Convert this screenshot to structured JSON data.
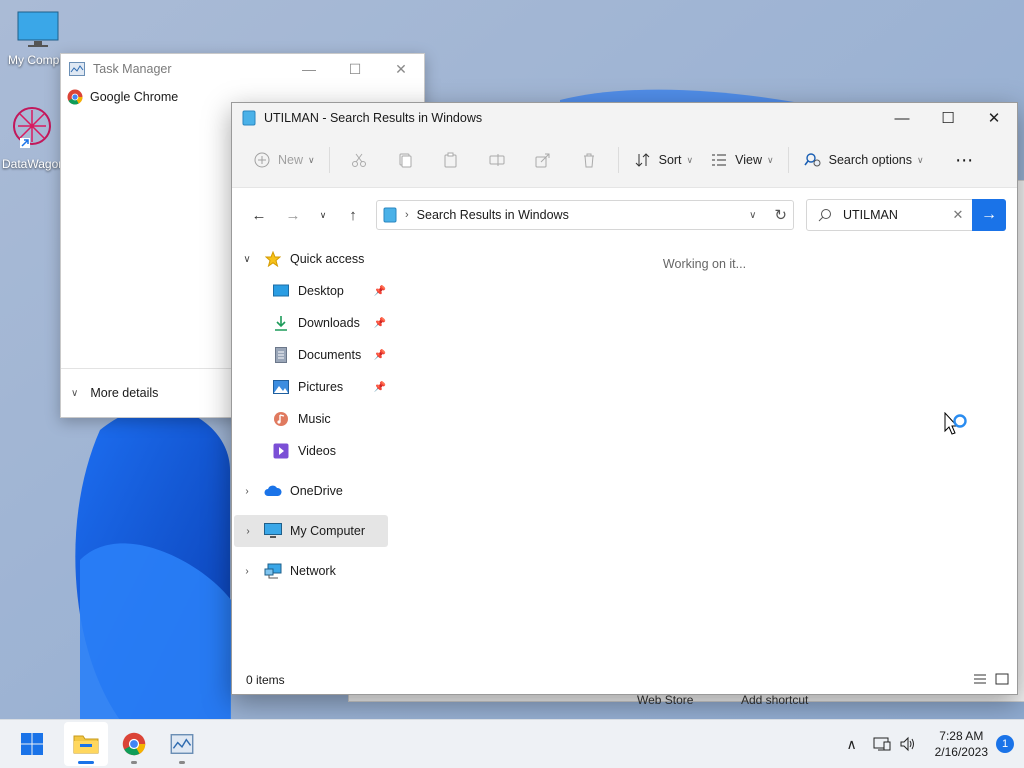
{
  "desktop": {
    "icons": [
      {
        "label": "My Computer"
      },
      {
        "label": "DataWagon"
      }
    ]
  },
  "task_manager": {
    "title": "Task Manager",
    "processes": [
      {
        "name": "Google Chrome"
      }
    ],
    "footer": "More details"
  },
  "behind_window": {
    "texts": [
      "Web Store",
      "Add shortcut"
    ]
  },
  "explorer": {
    "title": "UTILMAN - Search Results in Windows",
    "commands": {
      "new": "New",
      "sort": "Sort",
      "view": "View",
      "search_options": "Search options"
    },
    "address": "Search Results in Windows",
    "search_value": "UTILMAN",
    "nav": {
      "quick_access": "Quick access",
      "quick_items": [
        "Desktop",
        "Downloads",
        "Documents",
        "Pictures",
        "Music",
        "Videos"
      ],
      "onedrive": "OneDrive",
      "my_computer": "My Computer",
      "network": "Network"
    },
    "working_text": "Working on it...",
    "status": "0 items"
  },
  "taskbar": {
    "time": "7:28 AM",
    "date": "2/16/2023",
    "notifications": "1"
  },
  "colors": {
    "accent": "#1a73e8",
    "selection": "#e5e5e5"
  }
}
